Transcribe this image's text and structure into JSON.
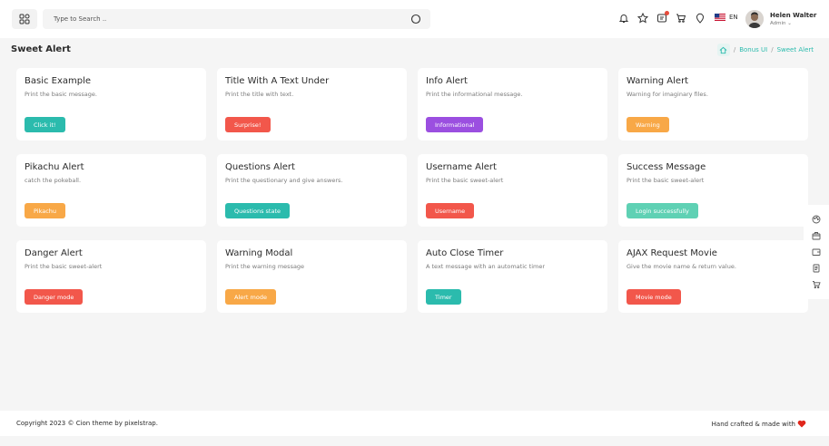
{
  "header": {
    "search": {
      "placeholder": "Type to Search .."
    },
    "language": "EN",
    "user": {
      "name": "Helen Walter",
      "role": "Admin"
    },
    "icons": [
      "grid-icon",
      "search-icon",
      "bell-icon",
      "star-icon",
      "message-icon",
      "cart-icon",
      "location-icon",
      "us-flag-icon"
    ]
  },
  "page": {
    "title": "Sweet Alert",
    "breadcrumb": [
      "Bonus UI",
      "Sweet Alert"
    ]
  },
  "colors": {
    "teal": "#2bbbad",
    "red": "#f2574b",
    "purple": "#9b4fe0",
    "orange": "#f8a847",
    "mint": "#5fd1b4",
    "background": "#f5f5f5"
  },
  "cards": [
    {
      "title": "Basic Example",
      "subtitle": "Print the basic message.",
      "button": "Click it!",
      "color": "#2bbbad"
    },
    {
      "title": "Title With A Text Under",
      "subtitle": "Print the title with text.",
      "button": "Surprise!",
      "color": "#f2574b"
    },
    {
      "title": "Info Alert",
      "subtitle": "Print the informational message.",
      "button": "Informational",
      "color": "#9b4fe0"
    },
    {
      "title": "Warning Alert",
      "subtitle": "Warning for imaginary files.",
      "button": "Warning",
      "color": "#f8a847"
    },
    {
      "title": "Pikachu Alert",
      "subtitle": "catch the pokeball.",
      "button": "Pikachu",
      "color": "#f8a847"
    },
    {
      "title": "Questions Alert",
      "subtitle": "Print the questionary and give answers.",
      "button": "Questions state",
      "color": "#2bbbad"
    },
    {
      "title": "Username Alert",
      "subtitle": "Print the basic sweet-alert",
      "button": "Username",
      "color": "#f2574b"
    },
    {
      "title": "Success Message",
      "subtitle": "Print the basic sweet-alert",
      "button": "Login successfully",
      "color": "#5fd1b4"
    },
    {
      "title": "Danger Alert",
      "subtitle": "Print the basic sweet-alert",
      "button": "Danger mode",
      "color": "#f2574b"
    },
    {
      "title": "Warning Modal",
      "subtitle": "Print the warning message",
      "button": "Alert mode",
      "color": "#f8a847"
    },
    {
      "title": "Auto Close Timer",
      "subtitle": "A text message with an automatic timer",
      "button": "Timer",
      "color": "#2bbbad"
    },
    {
      "title": "AJAX Request Movie",
      "subtitle": "Give the movie name & return value.",
      "button": "Movie mode",
      "color": "#f2574b"
    }
  ],
  "side_tools": [
    "palette-icon",
    "box-icon",
    "wallet-icon",
    "document-icon",
    "cart-icon"
  ],
  "footer": {
    "copyright": "Copyright 2023 © Cion theme by pixelstrap.",
    "crafted": "Hand crafted & made with"
  }
}
